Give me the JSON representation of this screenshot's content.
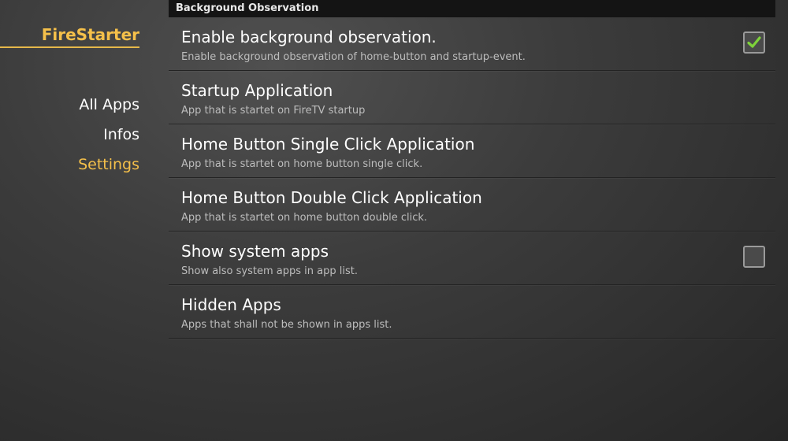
{
  "app": {
    "title": "FireStarter",
    "accent_color": "#f5c04a"
  },
  "nav": {
    "items": [
      {
        "label": "All Apps",
        "active": false
      },
      {
        "label": "Infos",
        "active": false
      },
      {
        "label": "Settings",
        "active": true
      }
    ]
  },
  "section": {
    "header": "Background Observation"
  },
  "settings": [
    {
      "title": "Enable background observation.",
      "subtitle": "Enable background observation of home-button and startup-event.",
      "has_checkbox": true,
      "checked": true
    },
    {
      "title": "Startup Application",
      "subtitle": "App that is startet on FireTV startup",
      "has_checkbox": false
    },
    {
      "title": "Home Button Single Click Application",
      "subtitle": "App that is startet on home button single click.",
      "has_checkbox": false
    },
    {
      "title": "Home Button Double Click Application",
      "subtitle": "App that is startet on home button double click.",
      "has_checkbox": false
    },
    {
      "title": "Show system apps",
      "subtitle": "Show also system apps in app list.",
      "has_checkbox": true,
      "checked": false
    },
    {
      "title": "Hidden Apps",
      "subtitle": "Apps that shall not be shown in apps list.",
      "has_checkbox": false
    }
  ],
  "icons": {
    "checkmark": "checkmark-icon",
    "checkmark_color": "#7ed23a"
  }
}
